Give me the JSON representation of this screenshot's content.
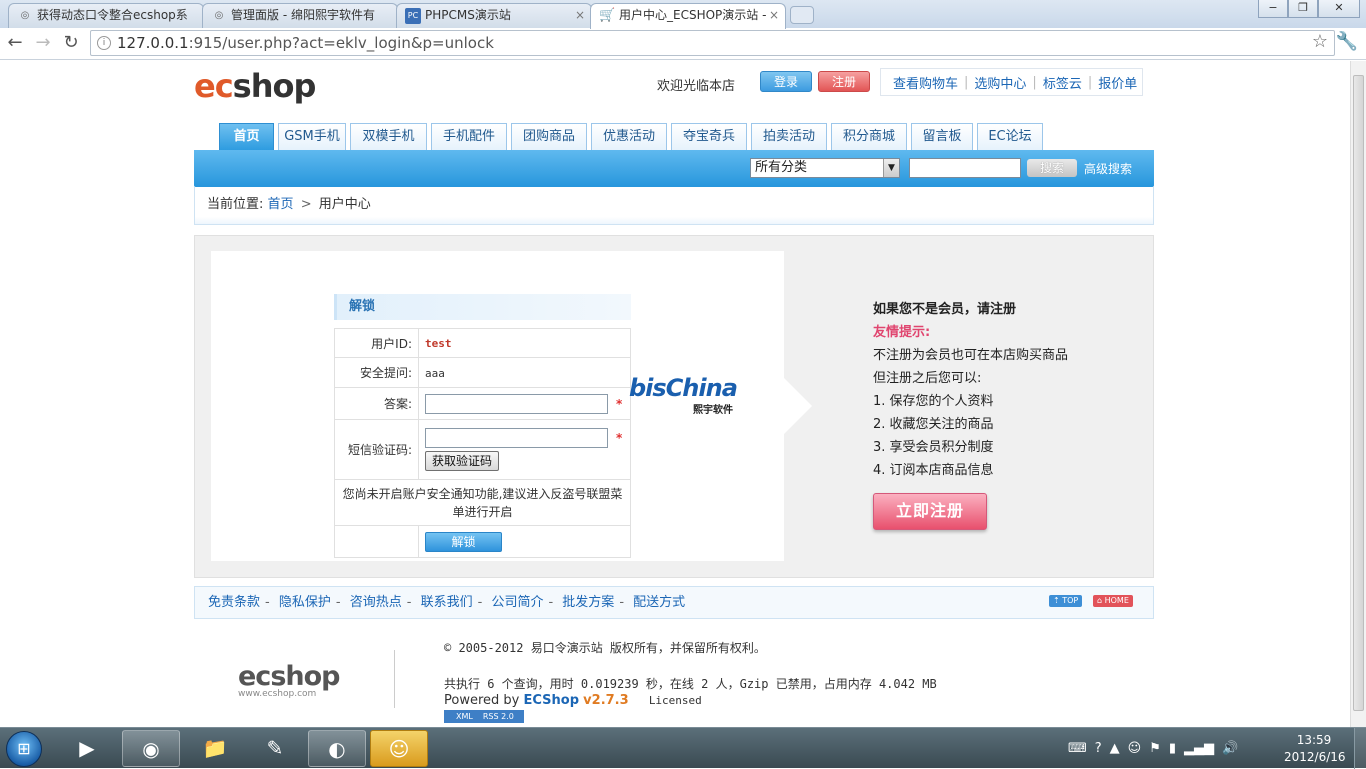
{
  "browser": {
    "tabs": [
      {
        "title": "获得动态口令整合ecshop系",
        "icon": "globe-icon"
      },
      {
        "title": "管理面版 - 绵阳熙宇软件有",
        "icon": "globe-icon"
      },
      {
        "title": "PHPCMS演示站",
        "icon": "phpcms-icon"
      },
      {
        "title": "用户中心_ECSHOP演示站 -",
        "icon": "cart-icon"
      }
    ],
    "url_host": "127.0.0.1",
    "url_rest": ":915/user.php?act=eklv_login&p=unlock",
    "win_min": "−",
    "win_max": "❐",
    "win_close": "✕"
  },
  "header": {
    "logo_ec": "ec",
    "logo_shop": "shop",
    "welcome": "欢迎光临本店",
    "login": "登录",
    "register": "注册",
    "toplinks": [
      "查看购物车",
      "选购中心",
      "标签云",
      "报价单"
    ]
  },
  "nav": {
    "items": [
      "首页",
      "GSM手机",
      "双模手机",
      "手机配件",
      "团购商品",
      "优惠活动",
      "夺宝奇兵",
      "拍卖活动",
      "积分商城",
      "留言板",
      "EC论坛"
    ],
    "active_index": 0
  },
  "search": {
    "category": "所有分类",
    "button": "搜索",
    "advanced": "高级搜索"
  },
  "breadcrumb": {
    "prefix": "当前位置:",
    "home": "首页",
    "arrow": ">",
    "current": "用户中心"
  },
  "unlock_form": {
    "title": "解锁",
    "userid_label": "用户ID:",
    "userid_value": "test",
    "question_label": "安全提问:",
    "question_value": "aaa",
    "answer_label": "答案:",
    "sms_label": "短信验证码:",
    "required": "*",
    "get_code": "获取验证码",
    "notice": "您尚未开启账户安全通知功能,建议进入反盗号联盟菜单进行开启",
    "submit": "解锁"
  },
  "partner_logo": {
    "text": "bisChina",
    "sub": "熙宇软件"
  },
  "register_panel": {
    "title": "如果您不是会员，请注册",
    "tip_heading": "友情提示:",
    "lines": [
      "不注册为会员也可在本店购买商品",
      "但注册之后您可以:",
      "1. 保存您的个人资料",
      "2. 收藏您关注的商品",
      "3. 享受会员积分制度",
      "4. 订阅本店商品信息"
    ],
    "button": "立即注册"
  },
  "footer_nav": {
    "links": [
      "免责条款",
      "隐私保护",
      "咨询热点",
      "联系我们",
      "公司简介",
      "批发方案",
      "配送方式"
    ],
    "top": "⇡ TOP",
    "home": "⌂ HOME"
  },
  "footer": {
    "logo": "ecshop",
    "logo_domain": "www.ecshop.com",
    "copyright": "© 2005-2012 易口令演示站 版权所有，并保留所有权利。",
    "stats": "共执行 6 个查询，用时 0.019239 秒，在线 2 人，Gzip 已禁用，占用内存 4.042 MB",
    "powered_prefix": "Powered by",
    "powered_name": "ECShop",
    "powered_version": "v2.7.3",
    "licensed": "Licensed",
    "feed_xml": "XML",
    "feed_rss": "RSS 2.0"
  },
  "taskbar": {
    "apps": [
      "media-player-icon",
      "chrome-icon",
      "explorer-icon",
      "notepad-icon",
      "app-icon",
      "qq-icon"
    ],
    "time": "13:59",
    "date": "2012/6/16"
  }
}
